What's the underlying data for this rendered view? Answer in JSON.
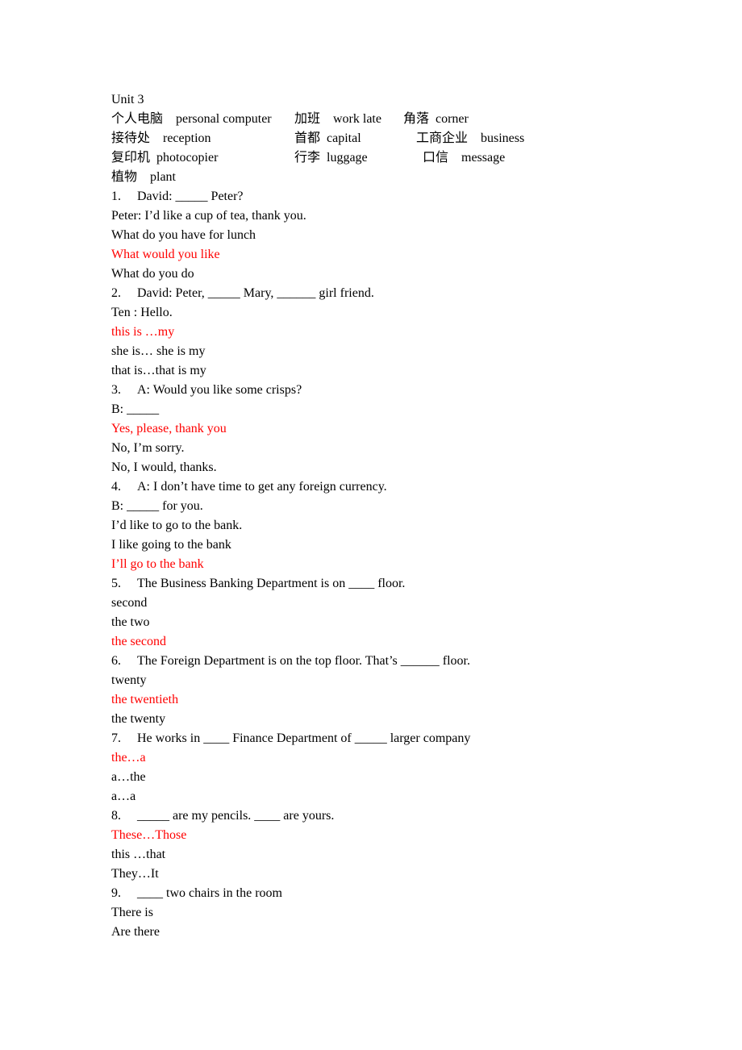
{
  "document": {
    "title": "Unit 3",
    "answer_color": "#ff0000",
    "text_color": "#000000",
    "background_color": "#ffffff"
  },
  "vocabulary": [
    {
      "col_a": "个人电脑  personal computer",
      "col_b": "加班  work late",
      "col_c": "角落 corner"
    },
    {
      "col_a": "接待处  reception",
      "col_b": "首都 capital",
      "col_c": "  工商企业  business"
    },
    {
      "col_a": "复印机 photocopier",
      "col_b": "行李 luggage",
      "col_c": "   口信  message"
    },
    {
      "col_a": "植物  plant",
      "col_b": "",
      "col_c": ""
    }
  ],
  "questions": [
    {
      "number": "1.",
      "prompt": "David: _____ Peter?",
      "extra_lines": [
        "Peter: I’d like a cup of tea, thank you."
      ],
      "options": [
        {
          "text": "What do you have for lunch",
          "correct": false
        },
        {
          "text": "What would you like",
          "correct": true
        },
        {
          "text": "What do you do",
          "correct": false
        }
      ]
    },
    {
      "number": "2.",
      "prompt": "David: Peter, _____ Mary, ______ girl friend.",
      "extra_lines": [
        "Ten : Hello."
      ],
      "options": [
        {
          "text": "this is …my",
          "correct": true
        },
        {
          "text": "she is… she is my",
          "correct": false
        },
        {
          "text": "that is…that is my",
          "correct": false
        }
      ]
    },
    {
      "number": "3.",
      "prompt": "A: Would you like some crisps?",
      "extra_lines": [
        "B: _____"
      ],
      "options": [
        {
          "text": "Yes, please, thank you",
          "correct": true
        },
        {
          "text": "No, I’m sorry.",
          "correct": false
        },
        {
          "text": "No, I would, thanks.",
          "correct": false
        }
      ]
    },
    {
      "number": "4.",
      "prompt": "A: I don’t have time to get any foreign currency.",
      "extra_lines": [
        "B: _____ for you."
      ],
      "options": [
        {
          "text": "I’d like to go to the bank.",
          "correct": false
        },
        {
          "text": "I like going to the bank",
          "correct": false
        },
        {
          "text": "I’ll go to the bank",
          "correct": true
        }
      ]
    },
    {
      "number": "5.",
      "prompt": "The Business Banking Department is on ____ floor.",
      "extra_lines": [],
      "options": [
        {
          "text": "second",
          "correct": false
        },
        {
          "text": "the two",
          "correct": false
        },
        {
          "text": "the second",
          "correct": true
        }
      ]
    },
    {
      "number": "6.",
      "prompt": "The Foreign Department is on the top floor. That’s ______ floor.",
      "extra_lines": [],
      "options": [
        {
          "text": "twenty",
          "correct": false
        },
        {
          "text": "the twentieth",
          "correct": true
        },
        {
          "text": "the twenty",
          "correct": false
        }
      ]
    },
    {
      "number": "7.",
      "prompt": "He works in ____ Finance Department of _____ larger company",
      "extra_lines": [],
      "options": [
        {
          "text": "the…a",
          "correct": true
        },
        {
          "text": "a…the",
          "correct": false
        },
        {
          "text": "a…a",
          "correct": false
        }
      ]
    },
    {
      "number": "8.",
      "prompt": "_____ are my pencils. ____ are yours.",
      "extra_lines": [],
      "options": [
        {
          "text": "These…Those",
          "correct": true
        },
        {
          "text": "this …that",
          "correct": false
        },
        {
          "text": "They…It",
          "correct": false
        }
      ]
    },
    {
      "number": "9.",
      "prompt": "____ two chairs in the room",
      "extra_lines": [],
      "options": [
        {
          "text": "There is",
          "correct": false
        },
        {
          "text": "Are there",
          "correct": false
        }
      ]
    }
  ]
}
